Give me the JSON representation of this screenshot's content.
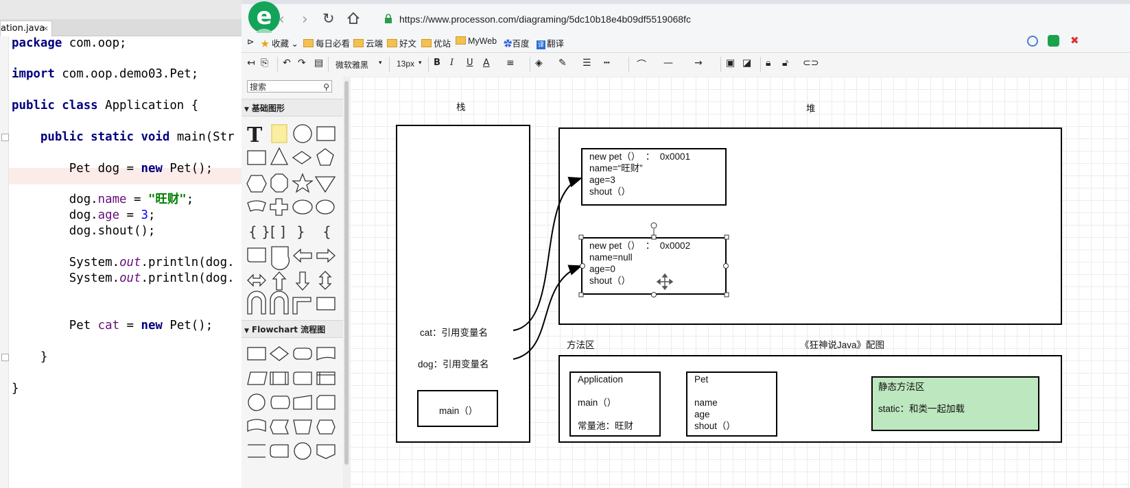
{
  "ide": {
    "tab_label": "ation.java",
    "tab_close": "×",
    "code_lines": [
      {
        "parts": [
          {
            "t": "package",
            "c": "kw"
          },
          {
            "t": " com.oop;",
            "c": ""
          }
        ]
      },
      {
        "parts": [
          {
            "t": "import",
            "c": "kw"
          },
          {
            "t": " com.oop.demo03.Pet;",
            "c": ""
          }
        ]
      },
      {
        "parts": [
          {
            "t": "public class",
            "c": "kw"
          },
          {
            "t": " Application {",
            "c": ""
          }
        ]
      },
      {
        "parts": [
          {
            "t": "    public static void",
            "c": "kw"
          },
          {
            "t": " main(Str",
            "c": ""
          }
        ]
      },
      {
        "parts": [
          {
            "t": "        Pet dog = ",
            "c": ""
          },
          {
            "t": "new",
            "c": "kw"
          },
          {
            "t": " Pet();",
            "c": ""
          }
        ]
      },
      {
        "parts": [
          {
            "t": "        dog.",
            "c": ""
          },
          {
            "t": "name",
            "c": "fld"
          },
          {
            "t": " = ",
            "c": ""
          },
          {
            "t": "\"旺财\"",
            "c": "str"
          },
          {
            "t": ";",
            "c": ""
          }
        ]
      },
      {
        "parts": [
          {
            "t": "        dog.",
            "c": ""
          },
          {
            "t": "age",
            "c": "fld"
          },
          {
            "t": " = ",
            "c": ""
          },
          {
            "t": "3",
            "c": "num"
          },
          {
            "t": ";",
            "c": ""
          }
        ]
      },
      {
        "parts": [
          {
            "t": "        dog.shout();",
            "c": ""
          }
        ]
      },
      {
        "parts": [
          {
            "t": "        System.",
            "c": ""
          },
          {
            "t": "out",
            "c": "it"
          },
          {
            "t": ".println(dog.",
            "c": ""
          }
        ]
      },
      {
        "parts": [
          {
            "t": "        System.",
            "c": ""
          },
          {
            "t": "out",
            "c": "it"
          },
          {
            "t": ".println(dog.",
            "c": ""
          }
        ]
      },
      {
        "parts": [
          {
            "t": "        Pet ",
            "c": ""
          },
          {
            "t": "cat",
            "c": "fld"
          },
          {
            "t": " = ",
            "c": ""
          },
          {
            "t": "new",
            "c": "kw"
          },
          {
            "t": " Pet();",
            "c": ""
          }
        ]
      },
      {
        "parts": [
          {
            "t": "    }",
            "c": ""
          }
        ]
      },
      {
        "parts": [
          {
            "t": "}",
            "c": ""
          }
        ]
      }
    ]
  },
  "browser": {
    "url": "https://www.processon.com/diagraming/5dc10b18e4b09df5519068fc",
    "bookmarks": [
      "收藏",
      "每日必看",
      "云端",
      "好文",
      "优站",
      "MyWeb",
      "百度",
      "翻译"
    ]
  },
  "toolbar": {
    "font_family": "微软雅黑",
    "font_size": "13px",
    "bold": "B",
    "italic": "I",
    "underline": "U",
    "font_color": "A"
  },
  "panel": {
    "search_placeholder": "搜索",
    "section_basic": "基础图形",
    "section_flow": "Flowchart 流程图"
  },
  "diagram": {
    "stack_title": "栈",
    "heap_title": "堆",
    "method_area_title": "方法区",
    "caption": "《狂神说Java》配图",
    "cat_label": "cat：引用变量名",
    "dog_label": "dog：引用变量名",
    "main_label": "main（）",
    "pet1_text": "new pet（）  ：  0x0001\nname=“旺财”\nage=3\nshout（）",
    "pet2_text": "new pet（）  ：  0x0002\nname=null\nage=0\nshout（）",
    "application_box": "Application\n\nmain（）\n\n常量池：旺财",
    "pet_class_box": "Pet\n\nname\nage\nshout（）",
    "static_area_title": "静态方法区",
    "static_area_text": "static：和类一起加载",
    "static_area_color": "#bde8bf"
  }
}
